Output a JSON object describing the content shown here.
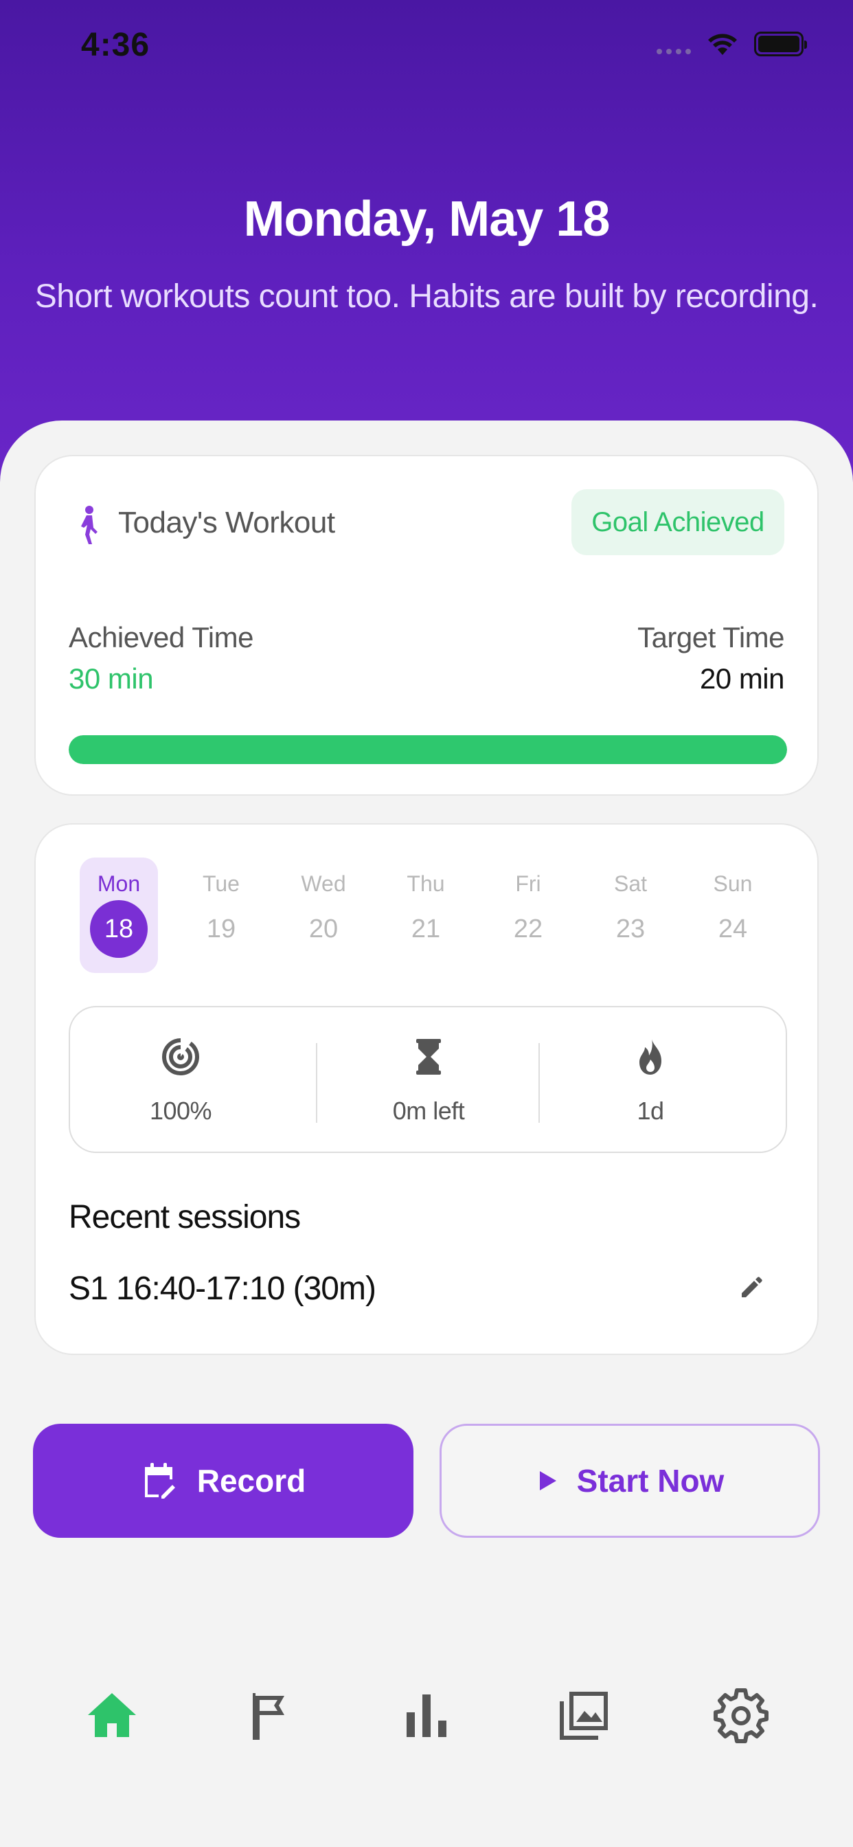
{
  "status_bar": {
    "time": "4:36"
  },
  "header": {
    "title": "Monday, May 18",
    "subtitle": "Short workouts count too. Habits are built by recording."
  },
  "workout_card": {
    "title": "Today's Workout",
    "badge": "Goal Achieved",
    "achieved_label": "Achieved Time",
    "achieved_value": "30 min",
    "target_label": "Target Time",
    "target_value": "20 min",
    "progress_percent": 100,
    "colors": {
      "achieved": "#2ec36a",
      "badge_bg": "#e8f7ee",
      "bar": "#2ec86e"
    }
  },
  "week": {
    "days": [
      {
        "name": "Mon",
        "num": "18",
        "selected": true
      },
      {
        "name": "Tue",
        "num": "19",
        "selected": false
      },
      {
        "name": "Wed",
        "num": "20",
        "selected": false
      },
      {
        "name": "Thu",
        "num": "21",
        "selected": false
      },
      {
        "name": "Fri",
        "num": "22",
        "selected": false
      },
      {
        "name": "Sat",
        "num": "23",
        "selected": false
      },
      {
        "name": "Sun",
        "num": "24",
        "selected": false
      }
    ]
  },
  "stats": [
    {
      "icon": "target-icon",
      "text": "100%"
    },
    {
      "icon": "hourglass-icon",
      "text": "0m left"
    },
    {
      "icon": "flame-icon",
      "text": "1d"
    }
  ],
  "recent": {
    "title": "Recent sessions",
    "sessions": [
      {
        "text": "S1  16:40-17:10 (30m)"
      }
    ]
  },
  "actions": {
    "record_label": "Record",
    "start_label": "Start Now"
  },
  "nav": [
    {
      "icon": "home-icon",
      "active": true
    },
    {
      "icon": "flag-icon",
      "active": false
    },
    {
      "icon": "bar-chart-icon",
      "active": false
    },
    {
      "icon": "gallery-icon",
      "active": false
    },
    {
      "icon": "settings-icon",
      "active": false
    }
  ],
  "colors": {
    "primary": "#7a2fd9",
    "active_nav": "#2ec36a",
    "header_start": "#4a17a3",
    "header_end": "#6a26c8"
  }
}
